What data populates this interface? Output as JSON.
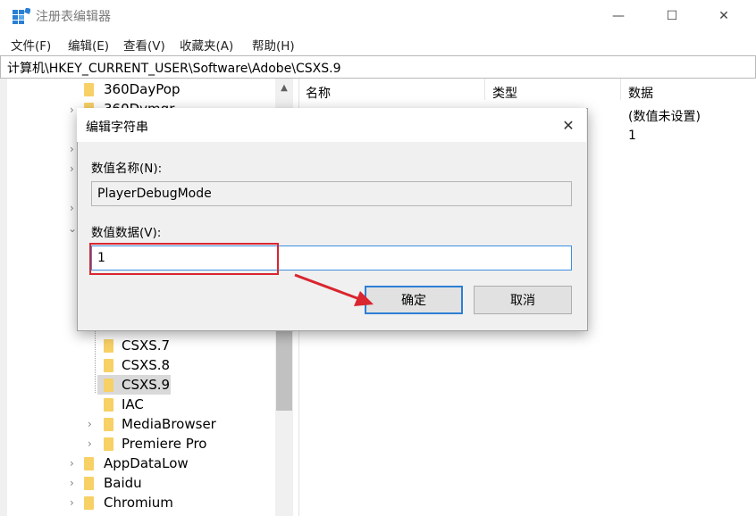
{
  "window": {
    "title": "注册表编辑器",
    "minimize": "—",
    "maximize": "☐",
    "close": "✕"
  },
  "menu": [
    "文件(F)",
    "编辑(E)",
    "查看(V)",
    "收藏夹(A)",
    "帮助(H)"
  ],
  "address": "计算机\\HKEY_CURRENT_USER\\Software\\Adobe\\CSXS.9",
  "tree": {
    "top_item": "360DayPop",
    "partial_item": "360Dvmgr",
    "items": [
      {
        "label": "CSXS.7"
      },
      {
        "label": "CSXS.8"
      },
      {
        "label": "CSXS.9",
        "selected": true
      },
      {
        "label": "IAC"
      },
      {
        "label": "MediaBrowser"
      },
      {
        "label": "Premiere Pro"
      }
    ],
    "root_items": [
      "AppDataLow",
      "Baidu",
      "Chromium"
    ]
  },
  "list": {
    "headers": {
      "name": "名称",
      "type": "类型",
      "data": "数据"
    },
    "rows": [
      {
        "name": "",
        "type": "",
        "data": "(数值未设置)"
      },
      {
        "name": "",
        "type": "",
        "data": "1"
      }
    ]
  },
  "dialog": {
    "title": "编辑字符串",
    "close": "✕",
    "name_label": "数值名称(N):",
    "name_value": "PlayerDebugMode",
    "data_label": "数值数据(V):",
    "data_value": "1",
    "ok": "确定",
    "cancel": "取消"
  },
  "colors": {
    "annotation": "#d9262f",
    "focus": "#2d7fd7",
    "folder": "#f7d066"
  }
}
